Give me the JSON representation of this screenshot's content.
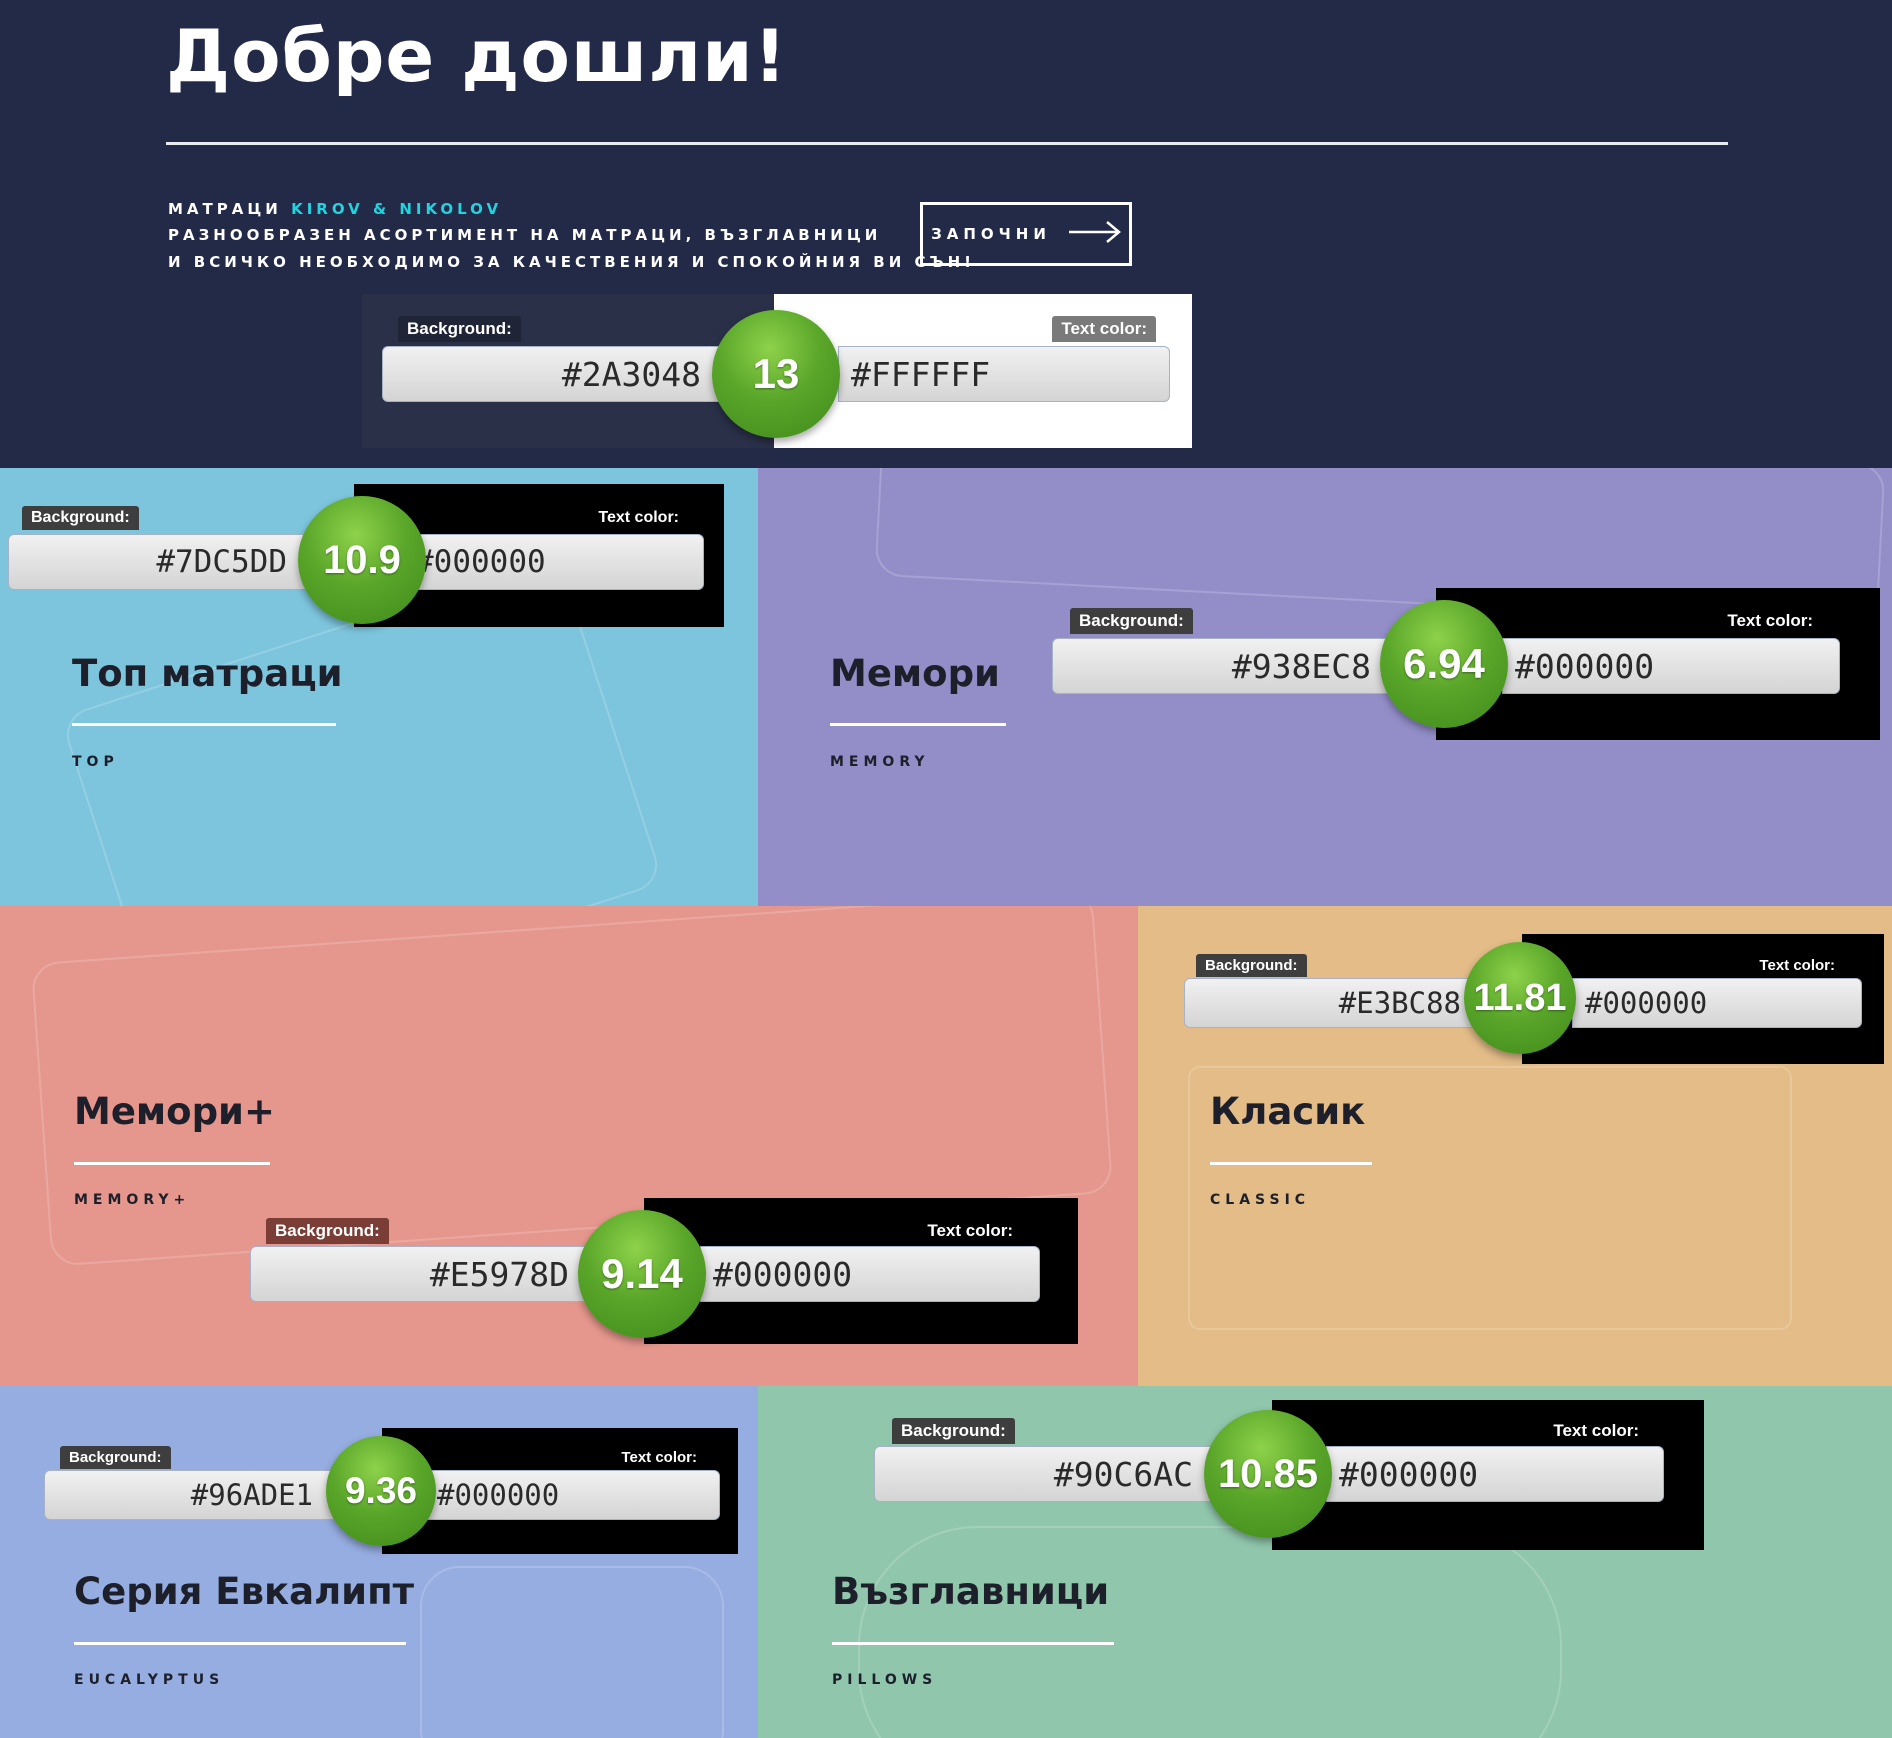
{
  "hero": {
    "title": "Добре дошли!",
    "line1_prefix": "МАТРАЦИ",
    "line1_brand": "KIROV & NIKOLOV",
    "line2": "РАЗНООБРАЗЕН АСОРТИМЕНТ НА МАТРАЦИ, ВЪЗГЛАВНИЦИ",
    "line3": "И ВСИЧКО НЕОБХОДИМО ЗА КАЧЕСТВЕНИЯ И СПОКОЙНИЯ ВИ СЪН!",
    "button_label": "ЗАПОЧНИ",
    "bg_color": "#232a48"
  },
  "contrast_labels": {
    "background": "Background:",
    "text_color": "Text color:"
  },
  "checks": {
    "hero": {
      "bg": "#2A3048",
      "fg": "#FFFFFF",
      "ratio": "13"
    },
    "top": {
      "bg": "#7DC5DD",
      "fg": "#000000",
      "ratio": "10.9"
    },
    "memory": {
      "bg": "#938EC8",
      "fg": "#000000",
      "ratio": "6.94"
    },
    "memory_plus": {
      "bg": "#E5978D",
      "fg": "#000000",
      "ratio": "9.14"
    },
    "classic": {
      "bg": "#E3BC88",
      "fg": "#000000",
      "ratio": "11.81"
    },
    "eucalyptus": {
      "bg": "#96ADE1",
      "fg": "#000000",
      "ratio": "9.36"
    },
    "pillows": {
      "bg": "#90C6AC",
      "fg": "#000000",
      "ratio": "10.85"
    }
  },
  "tiles": {
    "top": {
      "title": "Топ матраци",
      "sub": "TOP"
    },
    "memory": {
      "title": "Мемори",
      "sub": "MEMORY"
    },
    "memory_plus": {
      "title": "Мемори+",
      "sub": "MEMORY+"
    },
    "classic": {
      "title": "Класик",
      "sub": "CLASSIC"
    },
    "eucalyptus": {
      "title": "Серия Евкалипт",
      "sub": "EUCALYPTUS"
    },
    "pillows": {
      "title": "Възглавници",
      "sub": "PILLOWS"
    }
  },
  "icons": {
    "start_arrow": "arrow-right-icon"
  }
}
